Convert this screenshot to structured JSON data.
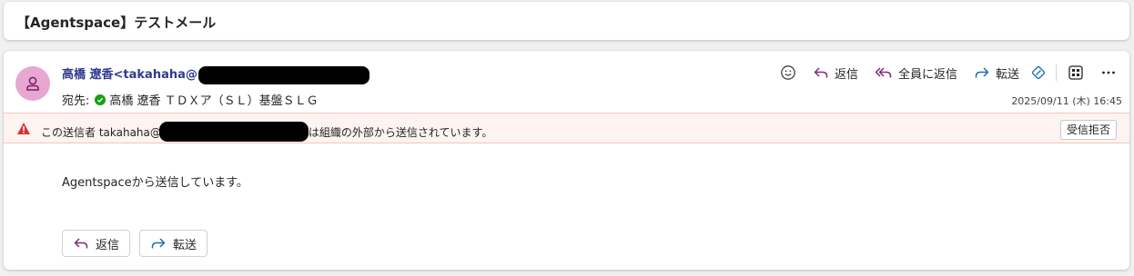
{
  "subject": "【Agentspace】テストメール",
  "sender": {
    "display": "高橋 遼香<takahaha@",
    "avatar_color": "#e8a6d2"
  },
  "recipients": {
    "label": "宛先:",
    "name": "高橋 遼香 ＴＤＸア（ＳＬ）基盤ＳＬＧ"
  },
  "actions": {
    "emoji_icon": "smiley-icon",
    "reply": "返信",
    "reply_all": "全員に返信",
    "forward": "転送"
  },
  "date": "2025/09/11 (木) 16:45",
  "warning": {
    "prefix": "この送信者 takahaha@",
    "suffix": "は組織の外部から送信されています。",
    "block_button": "受信拒否"
  },
  "body": "Agentspaceから送信しています。",
  "footer": {
    "reply": "返信",
    "forward": "転送"
  },
  "colors": {
    "sender": "#2f3a8f",
    "reply_arrow": "#7a2e73",
    "forward_arrow": "#1a6fb8",
    "warning_icon": "#d13438",
    "verified": "#13a10e"
  }
}
